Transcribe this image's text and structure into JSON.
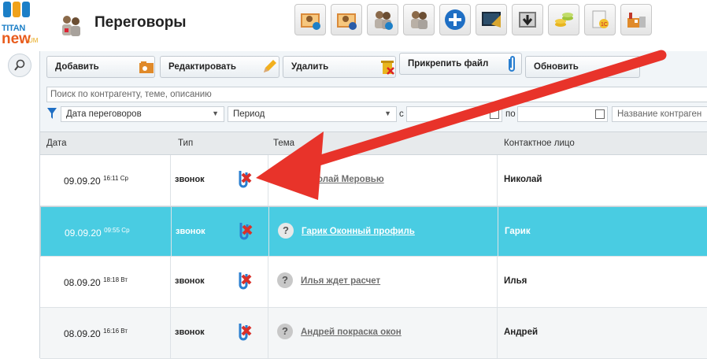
{
  "logo": {
    "line1": "TITAN",
    "line2": "new",
    "line3": "UM"
  },
  "header": {
    "title": "Переговоры"
  },
  "top_icons": [
    "add-contact-icon",
    "contact-info-icon",
    "users-add-icon",
    "users-icon",
    "plus-circle-icon",
    "monitor-icon",
    "download-icon",
    "coins-icon",
    "1c-document-icon",
    "factory-icon"
  ],
  "toolbar": {
    "add_label": "Добавить",
    "edit_label": "Редактировать",
    "delete_label": "Удалить",
    "attach_label": "Прикрепить файл",
    "refresh_label": "Обновить"
  },
  "search": {
    "placeholder": "Поиск по контрагенту, теме, описанию"
  },
  "filters": {
    "date_field": "Дата переговоров",
    "period": "Период",
    "from_label": "с",
    "to_label": "по",
    "counterparty_placeholder": "Название контраген"
  },
  "table": {
    "headers": {
      "date": "Дата",
      "type": "Тип",
      "topic": "Тема",
      "contact": "Контактное лицо"
    },
    "rows": [
      {
        "date": "09.09.20",
        "time": "16:11 Ср",
        "type": "звонок",
        "topic": "Николай Меровью",
        "contact": "Николай",
        "selected": false
      },
      {
        "date": "09.09.20",
        "time": "09:55 Ср",
        "type": "звонок",
        "topic": "Гарик Оконный профиль",
        "contact": "Гарик",
        "selected": true
      },
      {
        "date": "08.09.20",
        "time": "18:18 Вт",
        "type": "звонок",
        "topic": "Илья ждет расчет",
        "contact": "Илья",
        "selected": false
      },
      {
        "date": "08.09.20",
        "time": "16:16 Вт",
        "type": "звонок",
        "topic": "Андрей покраска окон",
        "contact": "Андрей",
        "selected": false
      }
    ]
  },
  "colors": {
    "selected_row": "#49cce2",
    "arrow": "#e8332a"
  }
}
